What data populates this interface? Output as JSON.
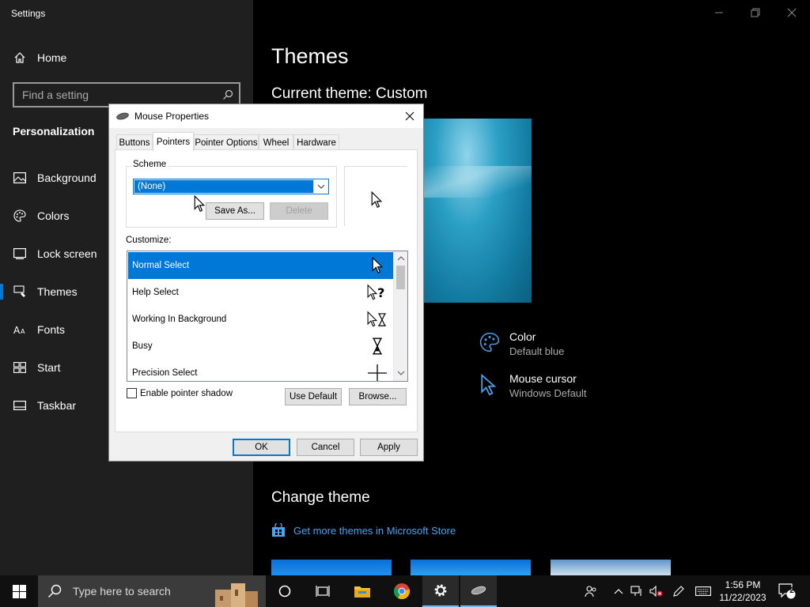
{
  "settings": {
    "window_title": "Settings",
    "home_label": "Home",
    "search_placeholder": "Find a setting",
    "section": "Personalization",
    "nav": [
      {
        "label": "Background"
      },
      {
        "label": "Colors"
      },
      {
        "label": "Lock screen"
      },
      {
        "label": "Themes"
      },
      {
        "label": "Fonts"
      },
      {
        "label": "Start"
      },
      {
        "label": "Taskbar"
      }
    ],
    "active_nav": "Themes",
    "accent_color": "#0078d7"
  },
  "content": {
    "page_title": "Themes",
    "current_theme": "Current theme: Custom",
    "props": [
      {
        "name": "Color",
        "value": "Default blue",
        "icon": "palette-icon"
      },
      {
        "name": "Mouse cursor",
        "value": "Windows Default",
        "icon": "cursor-icon"
      }
    ],
    "change_theme": "Change theme",
    "store_link": "Get more themes in Microsoft Store",
    "link_color": "#4aa3f0"
  },
  "dialog": {
    "title": "Mouse Properties",
    "tabs": [
      "Buttons",
      "Pointers",
      "Pointer Options",
      "Wheel",
      "Hardware"
    ],
    "selected_tab": "Pointers",
    "scheme_label": "Scheme",
    "scheme_value": "(None)",
    "save_as": "Save As...",
    "delete": "Delete",
    "customize_label": "Customize:",
    "pointers": [
      {
        "label": "Normal Select",
        "icon": "arrow-cursor-icon"
      },
      {
        "label": "Help Select",
        "icon": "help-cursor-icon"
      },
      {
        "label": "Working In Background",
        "icon": "working-cursor-icon"
      },
      {
        "label": "Busy",
        "icon": "hourglass-icon"
      },
      {
        "label": "Precision Select",
        "icon": "crosshair-icon"
      }
    ],
    "selected_pointer": "Normal Select",
    "enable_shadow": "Enable pointer shadow",
    "use_default": "Use Default",
    "browse": "Browse...",
    "ok": "OK",
    "cancel": "Cancel",
    "apply": "Apply"
  },
  "taskbar": {
    "search_placeholder": "Type here to search",
    "time": "1:56 PM",
    "date": "11/22/2023",
    "notification_count": "2"
  }
}
